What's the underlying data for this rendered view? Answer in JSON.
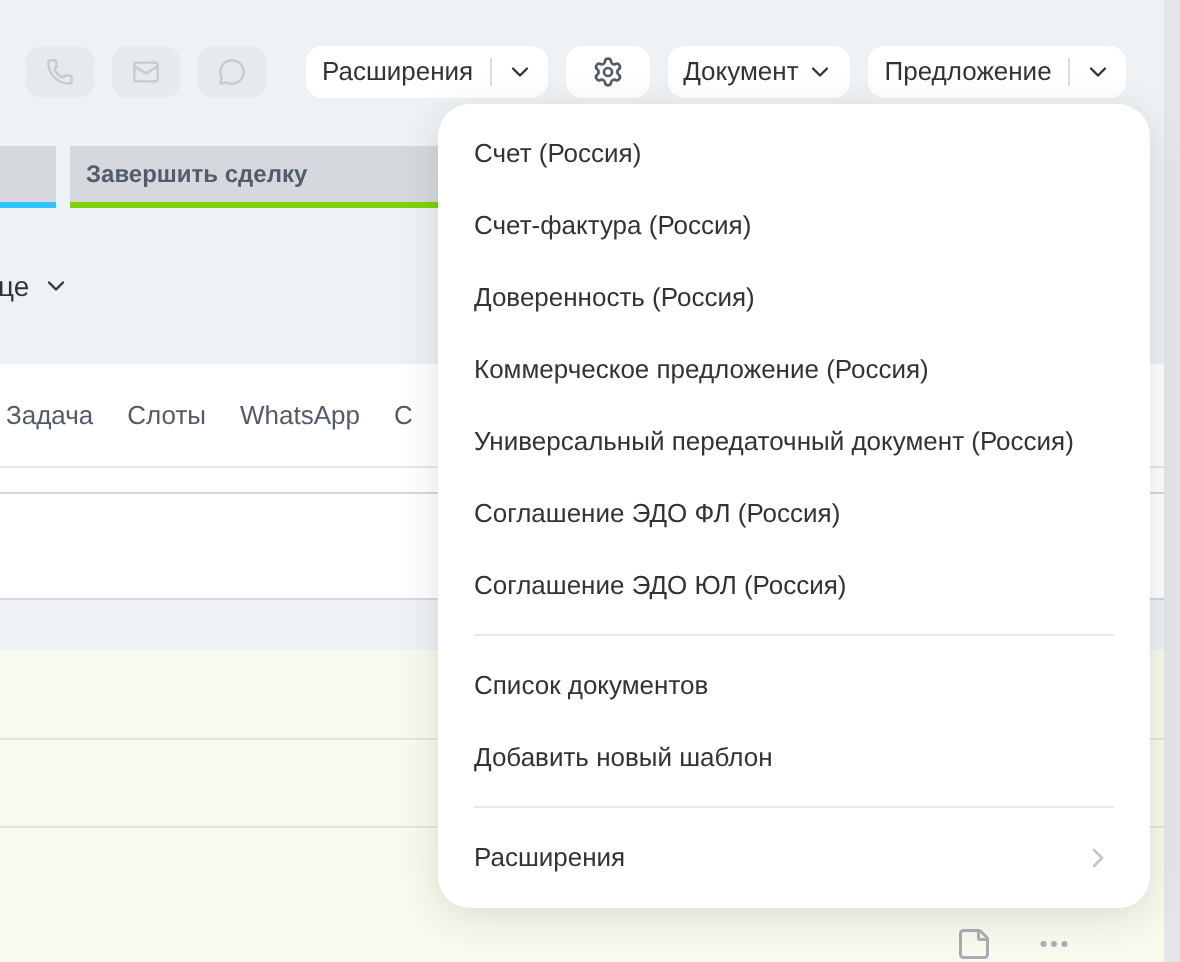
{
  "toolbar": {
    "icon_buttons": [
      {
        "kind": "phone",
        "disabled": true
      },
      {
        "kind": "mail",
        "disabled": true
      },
      {
        "kind": "chat",
        "disabled": true
      }
    ],
    "buttons": [
      {
        "kind": "split",
        "label": "Расширения"
      },
      {
        "kind": "gear"
      },
      {
        "kind": "dropdown",
        "label": "Документ"
      },
      {
        "kind": "split",
        "label": "Предложение"
      }
    ]
  },
  "stages": [
    {
      "color": "#2fc6f6"
    },
    {
      "label": "Завершить сделку",
      "color": "#7bd500"
    }
  ],
  "section_dropdown": {
    "label": "це"
  },
  "tabs": [
    "Задача",
    "Слоты",
    "WhatsApp",
    "С"
  ],
  "document_menu": {
    "groups": [
      {
        "items": [
          {
            "label": "Счет (Россия)"
          },
          {
            "label": "Счет-фактура (Россия)"
          },
          {
            "label": "Доверенность (Россия)"
          },
          {
            "label": "Коммерческое предложение (Россия)"
          },
          {
            "label": "Универсальный передаточный документ (Россия)"
          },
          {
            "label": "Соглашение ЭДО ФЛ (Россия)"
          },
          {
            "label": "Соглашение ЭДО ЮЛ (Россия)"
          }
        ]
      },
      {
        "items": [
          {
            "label": "Список документов"
          },
          {
            "label": "Добавить новый шаблон"
          }
        ]
      },
      {
        "items": [
          {
            "label": "Расширения",
            "submenu": true
          }
        ]
      }
    ]
  }
}
